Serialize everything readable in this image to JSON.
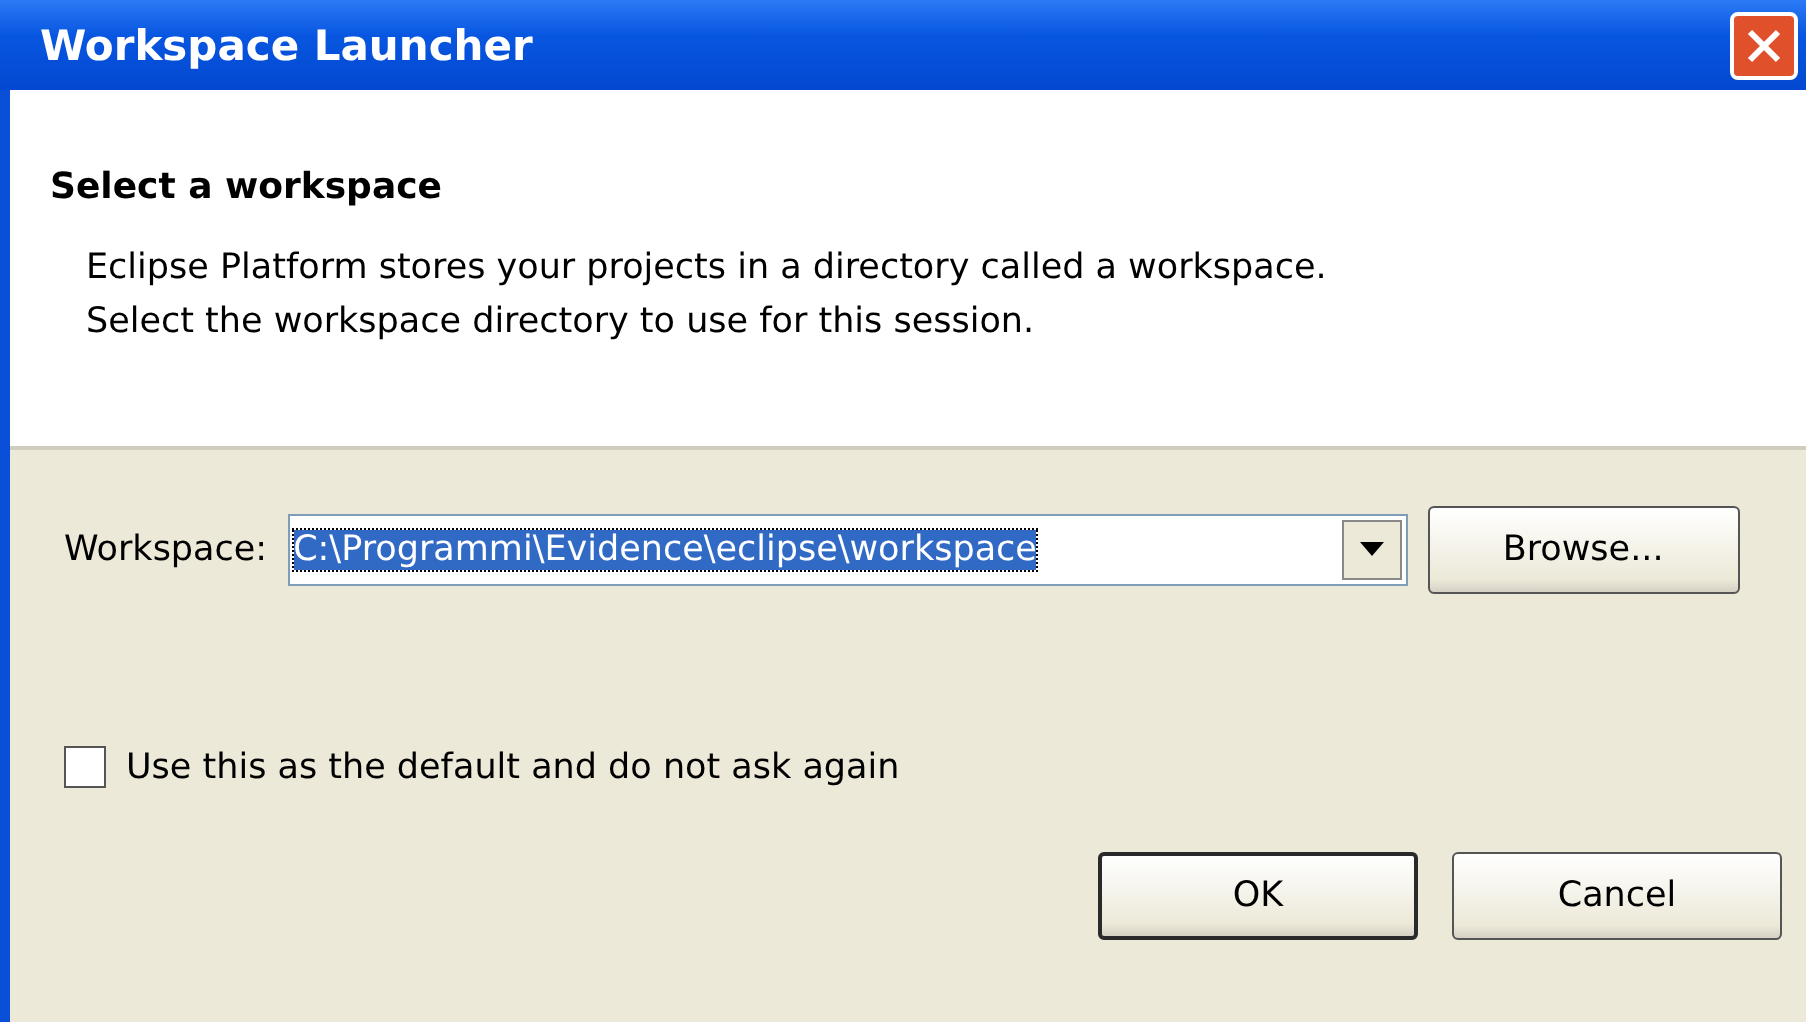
{
  "window": {
    "title": "Workspace Launcher"
  },
  "header": {
    "title": "Select a workspace",
    "lines": [
      "Eclipse Platform stores your projects in a directory called a workspace.",
      "Select the workspace directory to use for this session."
    ]
  },
  "workspace": {
    "label": "Workspace:",
    "value": "C:\\Programmi\\Evidence\\eclipse\\workspace",
    "selected": true,
    "browse": "Browse..."
  },
  "checkbox": {
    "label": "Use this as the default and do not ask again",
    "checked": false
  },
  "buttons": [
    {
      "label": "OK",
      "default": true
    },
    {
      "label": "Cancel",
      "default": false
    }
  ]
}
